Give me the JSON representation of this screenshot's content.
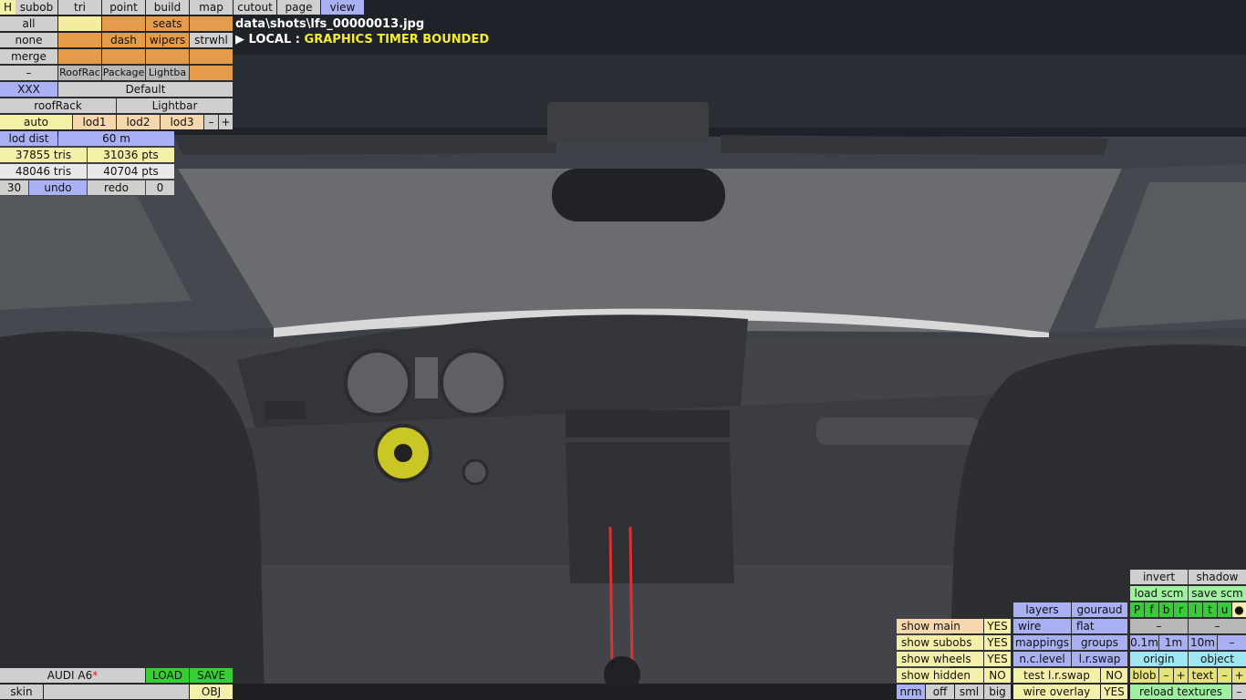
{
  "top_menu": [
    "H",
    "subob",
    "tri",
    "point",
    "build",
    "map",
    "cutout",
    "page",
    "view"
  ],
  "parts": {
    "all": "all",
    "none": "none",
    "merge": "merge",
    "dash_minus": "–",
    "seats": "seats",
    "dash": "dash",
    "wipers": "wipers",
    "strwhl": "strwhl",
    "roofrac": "RoofRac",
    "package": "Package",
    "lightba": "Lightba"
  },
  "config": {
    "xxx": "XXX",
    "default": "Default",
    "roofrack": "roofRack",
    "lightbar": "Lightbar"
  },
  "lod": {
    "auto": "auto",
    "lod1": "lod1",
    "lod2": "lod2",
    "lod3": "lod3",
    "minus": "–",
    "plus": "+",
    "dist_label": "lod dist",
    "dist_value": "60 m"
  },
  "stats": {
    "tris1": "37855 tris",
    "pts1": "31036 pts",
    "tris2": "48046 tris",
    "pts2": "40704 pts"
  },
  "history": {
    "count": "30",
    "undo": "undo",
    "redo": "redo",
    "redo_count": "0"
  },
  "overlay": {
    "filename": "data\\shots\\lfs_00000013.jpg",
    "prefix": "▶ LOCAL :",
    "message": "GRAPHICS TIMER BOUNDED"
  },
  "car": {
    "name": "AUDI A6",
    "modified_mark": "*",
    "load": "LOAD",
    "save": "SAVE",
    "skin": "skin",
    "obj": "OBJ"
  },
  "view_options": [
    {
      "label": "show main",
      "value": "YES"
    },
    {
      "label": "show subobs",
      "value": "YES"
    },
    {
      "label": "show wheels",
      "value": "YES"
    },
    {
      "label": "show hidden",
      "value": "NO"
    }
  ],
  "size_buttons": [
    "nrm",
    "off",
    "sml",
    "big"
  ],
  "render": {
    "layers": "layers",
    "gouraud": "gouraud",
    "wire": "wire",
    "flat": "flat",
    "mappings": "mappings",
    "groups": "groups",
    "nclevel": "n.c.level",
    "lrswap": "l.r.swap",
    "test_lrswap": "test l.r.swap",
    "test_value": "NO",
    "wire_overlay": "wire overlay",
    "wire_value": "YES"
  },
  "scene": {
    "invert": "invert",
    "shadow": "shadow",
    "load_scm": "load scm",
    "save_scm": "save scm",
    "layers": [
      "P",
      "f",
      "b",
      "r",
      "l",
      "t",
      "u",
      "●"
    ],
    "dash1": "–",
    "dash2": "–",
    "grid": [
      "0.1m",
      "1m",
      "10m",
      "–"
    ],
    "origin": "origin",
    "object": "object",
    "blob": "blob",
    "text": "text",
    "minus": "–",
    "plus": "+",
    "reload": "reload textures",
    "reload_minus": "–"
  }
}
